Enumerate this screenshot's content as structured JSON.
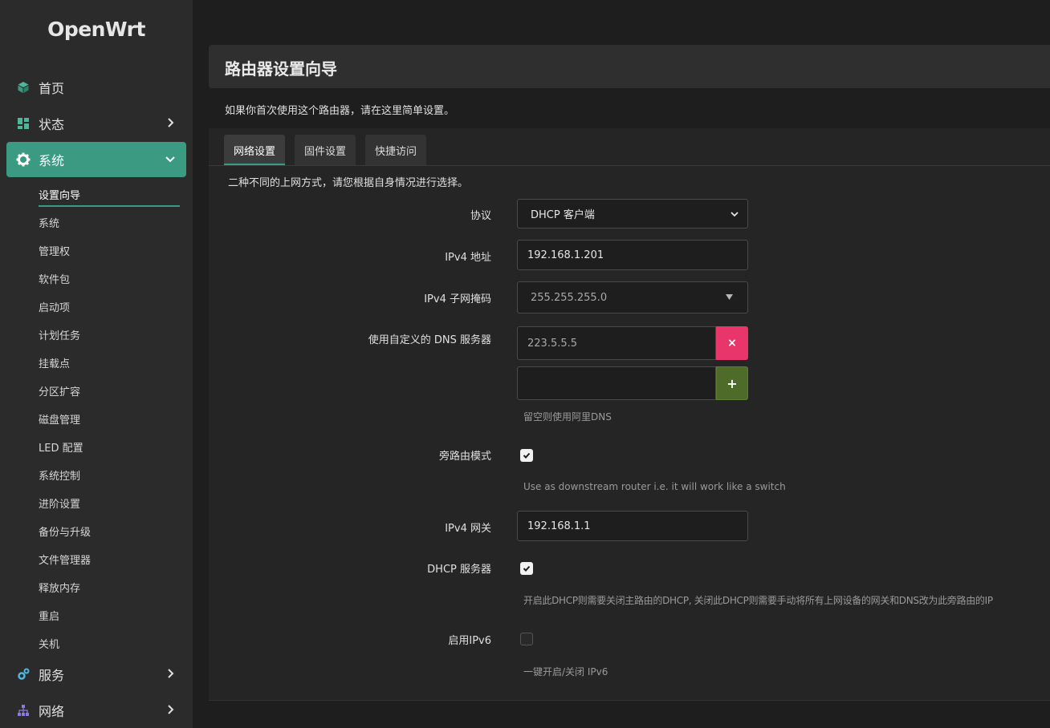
{
  "sidebar": {
    "logo": "OpenWrt",
    "nav": [
      {
        "label": "首页",
        "icon": "cube-icon"
      },
      {
        "label": "状态",
        "icon": "dashboard-icon"
      },
      {
        "label": "系统",
        "icon": "gear-icon"
      },
      {
        "label": "服务",
        "icon": "gears-icon"
      },
      {
        "label": "网络",
        "icon": "network-icon"
      }
    ],
    "system_items": [
      "设置向导",
      "系统",
      "管理权",
      "软件包",
      "启动项",
      "计划任务",
      "挂载点",
      "分区扩容",
      "磁盘管理",
      "LED 配置",
      "系统控制",
      "进阶设置",
      "备份与升级",
      "文件管理器",
      "释放内存",
      "重启",
      "关机"
    ]
  },
  "page": {
    "title": "路由器设置向导",
    "intro": "如果你首次使用这个路由器，请在这里简单设置。",
    "tabs": [
      "网络设置",
      "固件设置",
      "快捷访问"
    ],
    "section_desc": "二种不同的上网方式，请您根据自身情况进行选择。"
  },
  "form": {
    "protocol": {
      "label": "协议",
      "value": "DHCP 客户端"
    },
    "ipv4_addr": {
      "label": "IPv4 地址",
      "value": "192.168.1.201"
    },
    "netmask": {
      "label": "IPv4 子网掩码",
      "value": "255.255.255.0"
    },
    "dns": {
      "label": "使用自定义的 DNS 服务器",
      "value": "223.5.5.5",
      "new_value": "",
      "help": "留空则使用阿里DNS",
      "remove_label": "×",
      "add_label": "+"
    },
    "bypass": {
      "label": "旁路由模式",
      "checked": true,
      "help": "Use as downstream router i.e. it will work like a switch"
    },
    "gateway": {
      "label": "IPv4 网关",
      "value": "192.168.1.1"
    },
    "dhcp_server": {
      "label": "DHCP 服务器",
      "checked": true,
      "help": "开启此DHCP则需要关闭主路由的DHCP, 关闭此DHCP则需要手动将所有上网设备的网关和DNS改为此旁路由的IP"
    },
    "ipv6": {
      "label": "启用IPv6",
      "checked": false,
      "help": "一键开启/关闭 IPv6"
    }
  },
  "colors": {
    "accent": "#3a9a82",
    "danger": "#e8366a",
    "add": "#4f6b2a"
  }
}
